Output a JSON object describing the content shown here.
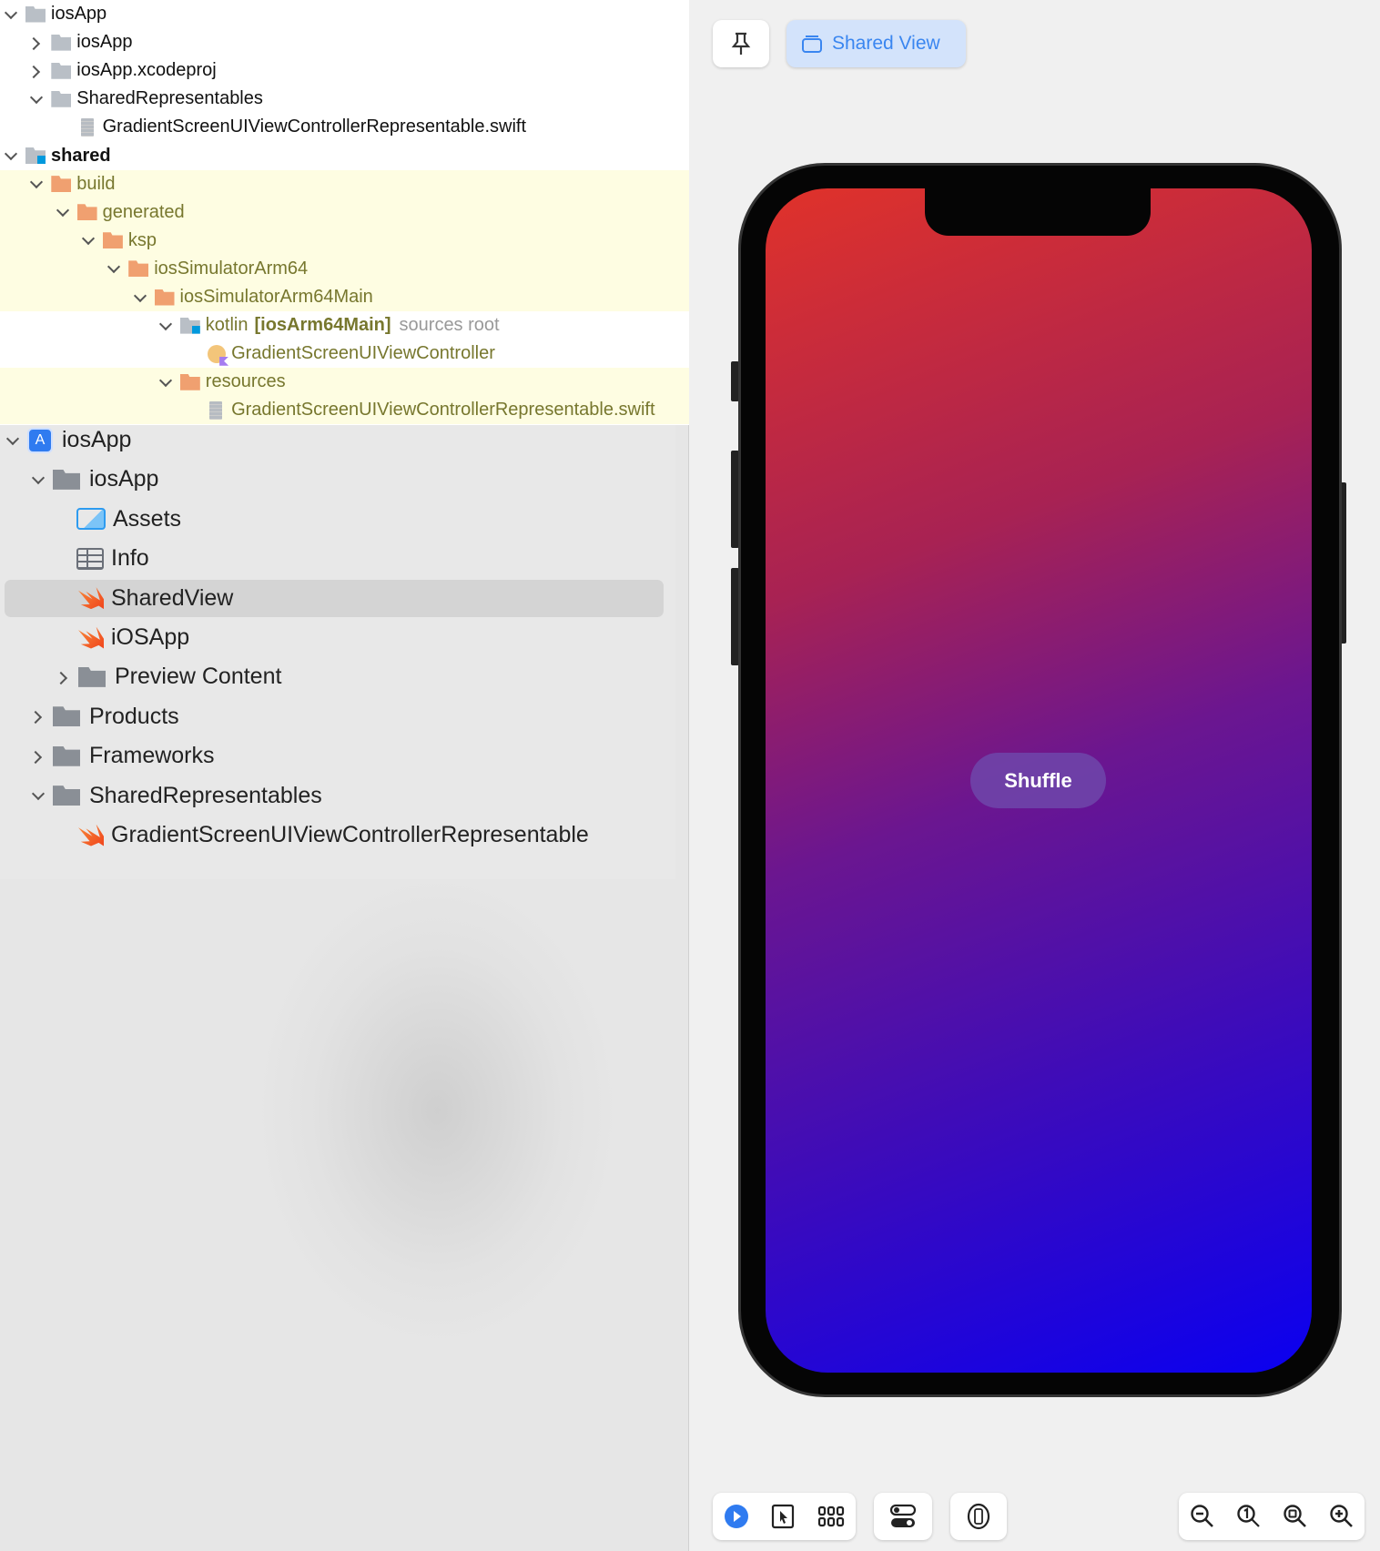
{
  "project_tree": [
    {
      "label": "iosApp",
      "depth": 0,
      "chevron": "down",
      "icon": "folder-gray"
    },
    {
      "label": "iosApp",
      "depth": 1,
      "chevron": "right",
      "icon": "folder-gray"
    },
    {
      "label": "iosApp.xcodeproj",
      "depth": 1,
      "chevron": "right",
      "icon": "folder-gray"
    },
    {
      "label": "SharedRepresentables",
      "depth": 1,
      "chevron": "down",
      "icon": "folder-gray"
    },
    {
      "label": "GradientScreenUIViewControllerRepresentable.swift",
      "depth": 2,
      "chevron": null,
      "icon": "file-doc"
    },
    {
      "label": "shared",
      "depth": 0,
      "chevron": "down",
      "icon": "folder-module",
      "bold": true
    },
    {
      "label": "build",
      "depth": 1,
      "chevron": "down",
      "icon": "folder-orange",
      "highlight": true
    },
    {
      "label": "generated",
      "depth": 2,
      "chevron": "down",
      "icon": "folder-orange",
      "highlight": true
    },
    {
      "label": "ksp",
      "depth": 3,
      "chevron": "down",
      "icon": "folder-orange",
      "highlight": true
    },
    {
      "label": "iosSimulatorArm64",
      "depth": 4,
      "chevron": "down",
      "icon": "folder-orange",
      "highlight": true
    },
    {
      "label": "iosSimulatorArm64Main",
      "depth": 5,
      "chevron": "down",
      "icon": "folder-orange",
      "highlight": true
    },
    {
      "label": "kotlin",
      "tag": "[iosArm64Main]",
      "note": "sources root",
      "depth": 6,
      "chevron": "down",
      "icon": "folder-module",
      "olive": true
    },
    {
      "label": "GradientScreenUIViewController",
      "depth": 7,
      "chevron": null,
      "icon": "kclass",
      "olive": true
    },
    {
      "label": "resources",
      "depth": 6,
      "chevron": "down",
      "icon": "folder-orange",
      "highlight": true
    },
    {
      "label": "GradientScreenUIViewControllerRepresentable.swift",
      "depth": 7,
      "chevron": null,
      "icon": "file-doc",
      "highlight": true
    }
  ],
  "xcode_navigator": [
    {
      "label": "iosApp",
      "depth": 0,
      "chevron": "down",
      "icon": "lxproj"
    },
    {
      "label": "iosApp",
      "depth": 1,
      "chevron": "down",
      "icon": "lf"
    },
    {
      "label": "Assets",
      "depth": 2,
      "chevron": null,
      "icon": "lassets"
    },
    {
      "label": "Info",
      "depth": 2,
      "chevron": null,
      "icon": "linfo"
    },
    {
      "label": "SharedView",
      "depth": 2,
      "chevron": null,
      "icon": "lswift",
      "selected": true
    },
    {
      "label": "iOSApp",
      "depth": 2,
      "chevron": null,
      "icon": "lswift"
    },
    {
      "label": "Preview Content",
      "depth": 2,
      "chevron": "right",
      "icon": "lf"
    },
    {
      "label": "Products",
      "depth": 1,
      "chevron": "right",
      "icon": "lf"
    },
    {
      "label": "Frameworks",
      "depth": 1,
      "chevron": "right",
      "icon": "lf"
    },
    {
      "label": "SharedRepresentables",
      "depth": 1,
      "chevron": "down",
      "icon": "lf"
    },
    {
      "label": "GradientScreenUIViewControllerRepresentable",
      "depth": 2,
      "chevron": null,
      "icon": "lswift"
    }
  ],
  "preview": {
    "pin_icon": "pin-icon",
    "shared_view_label": "Shared View",
    "shuffle_label": "Shuffle",
    "accent": "#3a86f0",
    "gradient_start": "#e0322a",
    "gradient_end": "#0a00f0"
  },
  "toolbar": {
    "left_group": [
      "live-preview-icon",
      "selectable-icon",
      "variants-grid-icon"
    ],
    "settings_icon": "canvas-settings-icon",
    "device_icon": "device-icon",
    "zoom_group": [
      "zoom-out-icon",
      "zoom-100-icon",
      "zoom-fit-icon",
      "zoom-in-icon"
    ]
  }
}
